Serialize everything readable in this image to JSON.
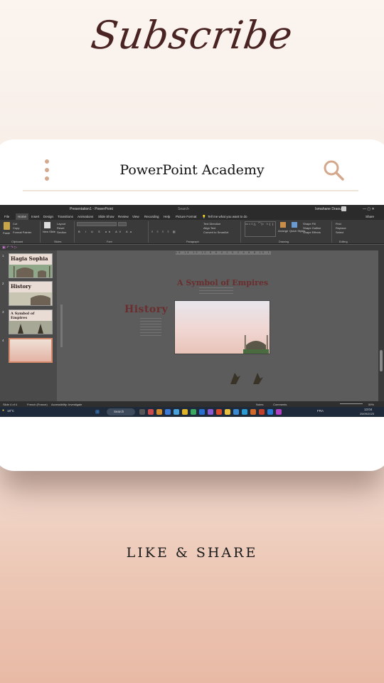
{
  "header": {
    "subscribe": "Subscribe"
  },
  "card": {
    "brand": "PowerPoint Academy",
    "icons": {
      "menu": "kebab-menu-icon",
      "search": "search-icon"
    },
    "accent": "#d4a88c"
  },
  "powerpoint": {
    "title": "Presentation1 - PowerPoint",
    "search": "Search",
    "user": "Ismahane Draoui",
    "tabs": [
      "File",
      "Home",
      "Insert",
      "Design",
      "Transitions",
      "Animations",
      "Slide Show",
      "Review",
      "View",
      "Recording",
      "Help",
      "Picture Format"
    ],
    "tell_me": "Tell me what you want to do",
    "share": "Share",
    "ribbon": {
      "paste": "Paste",
      "cut": "Cut",
      "copy": "Copy",
      "format_painter": "Format Painter",
      "new_slide": "New Slide",
      "layout": "Layout",
      "reset": "Reset",
      "section": "Section",
      "text_direction": "Text Direction",
      "align_text": "Align Text",
      "convert_smartart": "Convert to SmartArt",
      "arrange": "Arrange",
      "quick_styles": "Quick Styles",
      "shape_fill": "Shape Fill",
      "shape_outline": "Shape Outline",
      "shape_effects": "Shape Effects",
      "find": "Find",
      "replace": "Replace",
      "select": "Select",
      "groups": [
        "Clipboard",
        "Slides",
        "Font",
        "Paragraph",
        "Drawing",
        "Editing"
      ]
    },
    "slides": [
      {
        "num": "1",
        "title": "Hagia Sophia"
      },
      {
        "num": "2",
        "title": "History"
      },
      {
        "num": "3",
        "title": "A Symbol of Empires"
      },
      {
        "num": "4",
        "title": ""
      }
    ],
    "canvas": {
      "heading1": "A Symbol of Empires",
      "heading2": "History"
    },
    "status": {
      "slide": "Slide 4 of 4",
      "language": "French (France)",
      "accessibility": "Accessibility: Investigate",
      "notes": "Notes",
      "comments": "Comments",
      "zoom": "59%"
    },
    "taskbar": {
      "weather": "18°C",
      "search": "Search",
      "lang": "FRA",
      "time": "13:04",
      "date": "25/09/2023"
    }
  },
  "footer": {
    "like_share": "LIKE & SHARE"
  }
}
